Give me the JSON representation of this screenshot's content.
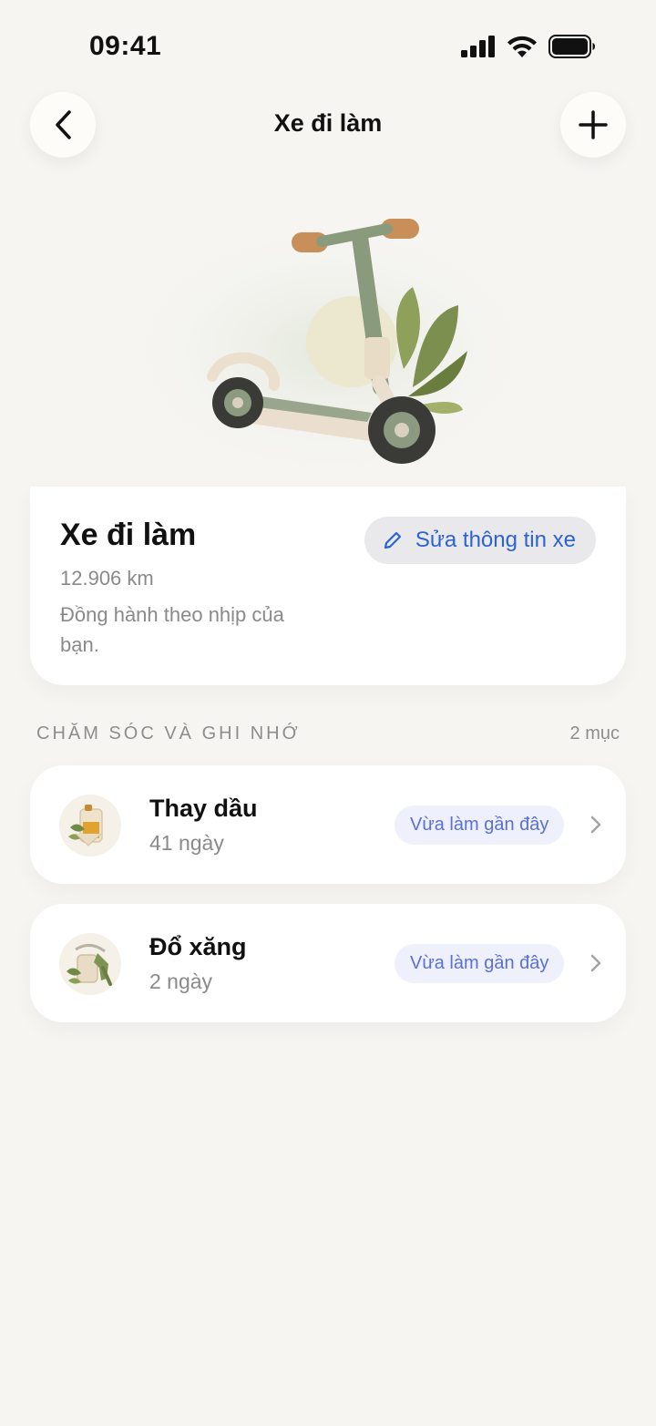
{
  "status_bar": {
    "time": "09:41"
  },
  "nav": {
    "title": "Xe đi làm"
  },
  "vehicle": {
    "name": "Xe đi làm",
    "odometer": "12.906 km",
    "tagline": "Đồng hành theo nhịp của bạn.",
    "edit_label": "Sửa thông tin xe"
  },
  "section": {
    "title": "CHĂM SÓC VÀ GHI NHỚ",
    "count": "2 mục"
  },
  "items": [
    {
      "title": "Thay dầu",
      "subtitle": "41 ngày",
      "badge": "Vừa làm gần đây",
      "icon": "oil-can-icon"
    },
    {
      "title": "Đổ xăng",
      "subtitle": "2 ngày",
      "badge": "Vừa làm gần đây",
      "icon": "fuel-pump-icon"
    }
  ],
  "colors": {
    "background": "#f6f5f2",
    "accent": "#2c63d4",
    "badge_text": "#5b6fd6",
    "badge_bg": "#eef0fc"
  }
}
